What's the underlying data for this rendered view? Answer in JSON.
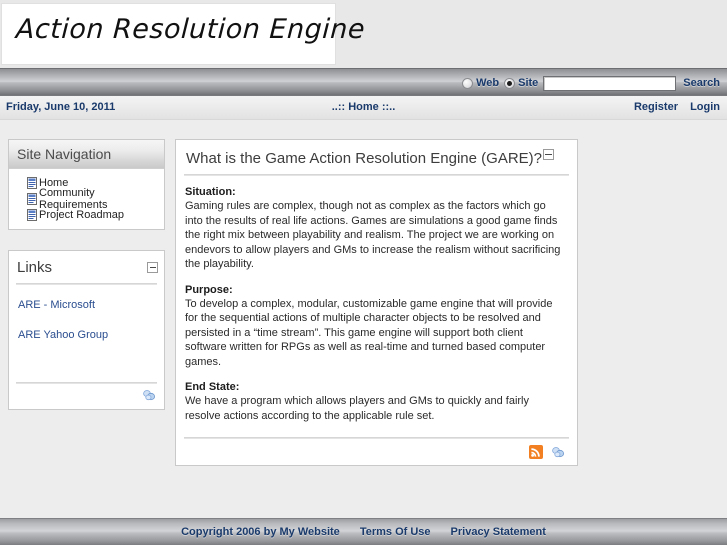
{
  "site": {
    "logo_text": "Action Resolution Engine"
  },
  "search": {
    "scope_web_label": "Web",
    "scope_site_label": "Site",
    "selected_scope": "Site",
    "input_value": "",
    "input_placeholder": "",
    "search_label": "Search"
  },
  "infobar": {
    "date": "Friday, June 10, 2011",
    "nav_prefix": "..::",
    "nav_home": "Home",
    "nav_suffix": "::..",
    "register_label": "Register",
    "login_label": "Login"
  },
  "sidebar": {
    "site_nav": {
      "title": "Site Navigation",
      "items": [
        {
          "label": "Home",
          "icon": "document-icon"
        },
        {
          "label": "Community Requirements",
          "icon": "document-icon"
        },
        {
          "label": "Project Roadmap",
          "icon": "document-icon"
        }
      ]
    },
    "links": {
      "title": "Links",
      "collapse_icon": "minus-icon",
      "items": [
        {
          "label": "ARE - Microsoft"
        },
        {
          "label": "ARE Yahoo Group"
        }
      ],
      "footer_icon": "print-icon"
    }
  },
  "main": {
    "title": "What is the Game Action Resolution Engine (GARE)?",
    "collapse_icon": "minus-icon",
    "sections": [
      {
        "label": "Situation:",
        "text": "Gaming rules are complex, though not as complex as the factors which go into the results of real life actions. Games are simulations a good game finds the right mix between playability and realism. The project we are working on endevors to allow players and GMs to increase the realism without sacrificing the playability."
      },
      {
        "label": "Purpose:",
        "text": "To develop a complex, modular, customizable game engine that will provide for the sequential actions of multiple character objects to be resolved and persisted in a “time stream”. This game engine will support both client software written for RPGs as well as real-time and turned based computer games."
      },
      {
        "label": "End State:",
        "text": "We have a program which allows players and GMs to quickly and fairly resolve actions according to the applicable rule set."
      }
    ],
    "footer_icons": [
      {
        "name": "rss-icon"
      },
      {
        "name": "print-icon"
      }
    ]
  },
  "footer": {
    "copyright": "Copyright 2006 by My Website",
    "terms": "Terms Of Use",
    "privacy": "Privacy Statement"
  },
  "colors": {
    "link_blue": "#1a3a6b",
    "body_link_blue": "#2a4d8f",
    "rss_orange": "#f28022",
    "page_background": "#ededed"
  }
}
